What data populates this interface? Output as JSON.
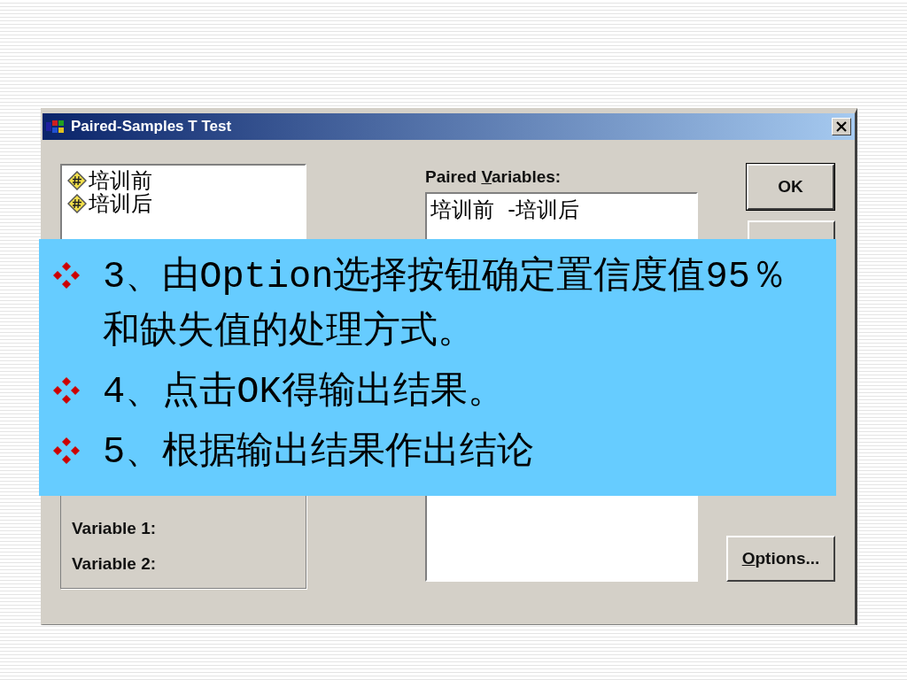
{
  "dialog": {
    "title": "Paired-Samples T Test",
    "variables": [
      {
        "name": "培训前"
      },
      {
        "name": "培训后"
      }
    ],
    "paired_label": {
      "before": "Paired ",
      "key": "V",
      "after": "ariables:"
    },
    "pairs": [
      "培训前  -培训后"
    ],
    "current_selections": [
      "Variable 1:",
      "Variable 2:"
    ],
    "buttons": [
      {
        "after": "OK"
      },
      {
        "key": "O",
        "after": "ptions..."
      }
    ]
  },
  "notes": [
    "3、由Option选择按钮确定置信度值95％和缺失值的处理方式。",
    "4、点击OK得输出结果。",
    "5、根据输出结果作出结论"
  ]
}
